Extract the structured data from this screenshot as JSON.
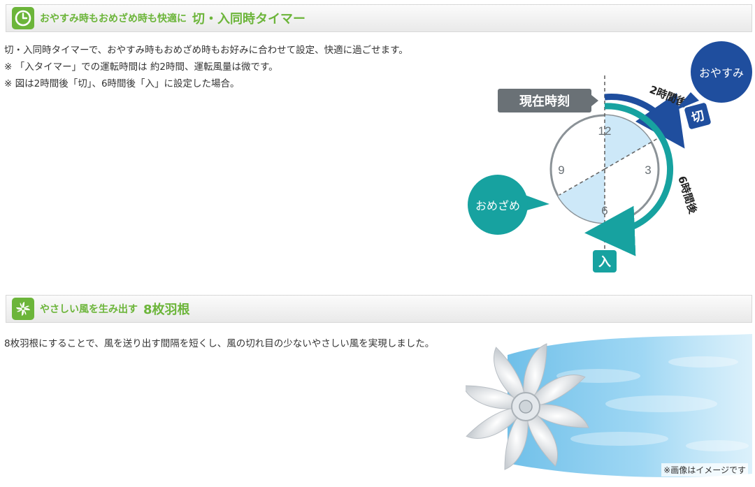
{
  "timer_section": {
    "heading_small": "おやすみ時もおめざめ時も快適に",
    "heading_large": "切・入同時タイマー",
    "icon": "clock-icon",
    "description": "切・入同時タイマーで、おやすみ時もおめざめ時もお好みに合わせて設定、快適に過ごせます。",
    "notes": [
      "※ 「入タイマー」での運転時間は 約2時間、運転風量は微です。",
      "※ 図は2時間後「切」、6時間後「入」に設定した場合。"
    ],
    "figure": {
      "current_time_label": "現在時刻",
      "oyasumi_label": "おやすみ",
      "omezame_label": "おめざめ",
      "off_label": "切",
      "on_label": "入",
      "after_2h_label": "2時間後",
      "after_6h_label": "6時間後",
      "clock_numbers": [
        "12",
        "3",
        "6",
        "9"
      ],
      "colors": {
        "navy": "#1f4e9e",
        "teal": "#17a2a0",
        "gray_label": "#6a7176",
        "sector": "#cde8f8"
      }
    }
  },
  "blade_section": {
    "heading_small": "やさしい風を生み出す",
    "heading_large": "8枚羽根",
    "icon": "fan-icon",
    "description": "8枚羽根にすることで、風を送り出す間隔を短くし、風の切れ目の少ないやさしい風を実現しました。",
    "image_caption": "※画像はイメージです"
  },
  "accent_color": "#6cb53a"
}
